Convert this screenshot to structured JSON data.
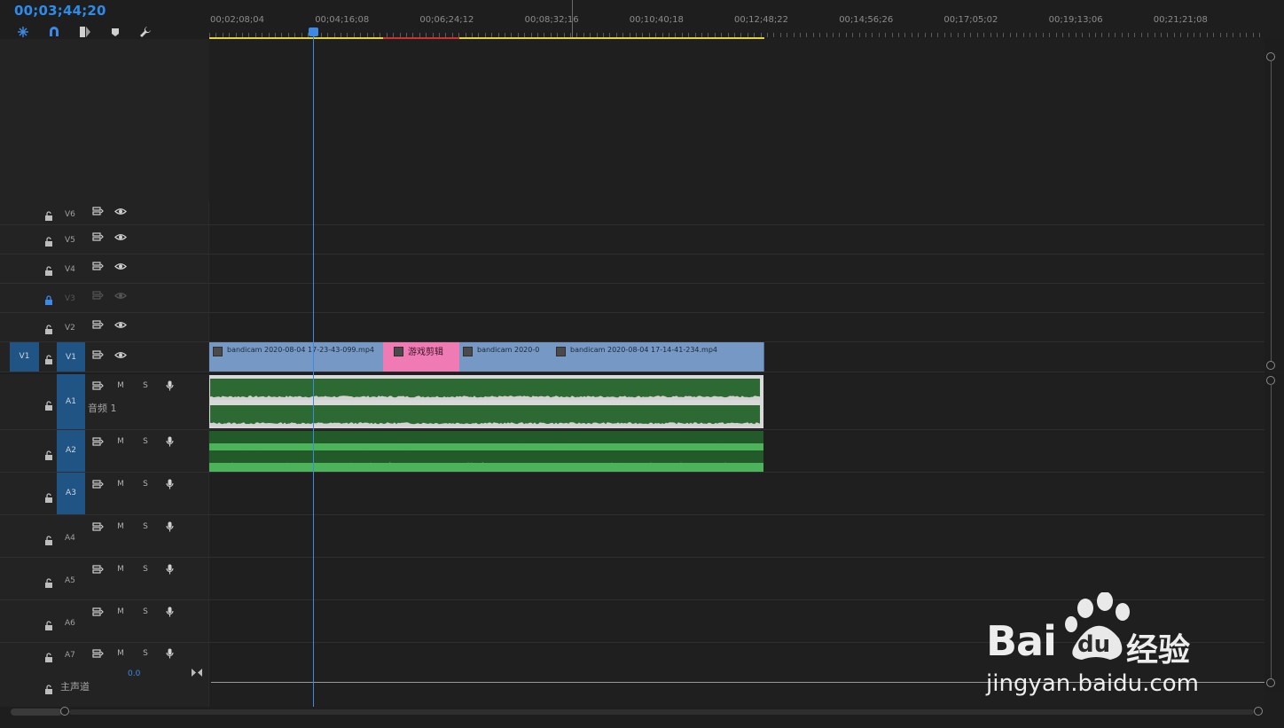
{
  "timecode": "00;03;44;20",
  "toolbar": {
    "tools": [
      "snap-icon",
      "magnet-icon",
      "linked-selection-icon",
      "marker-icon",
      "wrench-icon"
    ]
  },
  "ruler": {
    "labels": [
      "00;02;08;04",
      "00;04;16;08",
      "00;06;24;12",
      "00;08;32;16",
      "00;10;40;18",
      "00;12;48;22",
      "00;14;56;26",
      "00;17;05;02",
      "00;19;13;06",
      "00;21;21;08"
    ]
  },
  "video_tracks": [
    {
      "name": "V6",
      "locked": false,
      "visible": true
    },
    {
      "name": "V5",
      "locked": false,
      "visible": true
    },
    {
      "name": "V4",
      "locked": false,
      "visible": true
    },
    {
      "name": "V3",
      "locked": true,
      "visible": true
    },
    {
      "name": "V2",
      "locked": false,
      "visible": true
    },
    {
      "name": "V1",
      "source": "V1",
      "locked": false,
      "visible": true
    }
  ],
  "video_clips": [
    {
      "name": "bandicam 2020-08-04 17-23-43-099.mp4",
      "color": "#7599c4"
    },
    {
      "name": "游戏剪辑",
      "color": "#f07bb4"
    },
    {
      "name": "bandicam 2020-0",
      "color": "#7599c4"
    },
    {
      "name": "bandicam 2020-08-04 17-14-41-234.mp4",
      "color": "#7599c4"
    }
  ],
  "audio_tracks": [
    {
      "name": "A1",
      "label": "音频 1",
      "mute": "M",
      "solo": "S"
    },
    {
      "name": "A2",
      "mute": "M",
      "solo": "S"
    },
    {
      "name": "A3",
      "mute": "M",
      "solo": "S"
    },
    {
      "name": "A4",
      "mute": "M",
      "solo": "S"
    },
    {
      "name": "A5",
      "mute": "M",
      "solo": "S"
    },
    {
      "name": "A6",
      "mute": "M",
      "solo": "S"
    },
    {
      "name": "A7",
      "mute": "M",
      "solo": "S"
    }
  ],
  "master": {
    "label": "主声道",
    "value": "0.0"
  },
  "watermark": {
    "brand_left": "Bai",
    "brand_right": "du",
    "suffix": "经验",
    "url": "jingyan.baidu.com"
  },
  "colors": {
    "accent": "#2d8ceb",
    "clip_video": "#7599c4",
    "clip_pink": "#f07bb4",
    "audio_green": "#4cb35a"
  }
}
